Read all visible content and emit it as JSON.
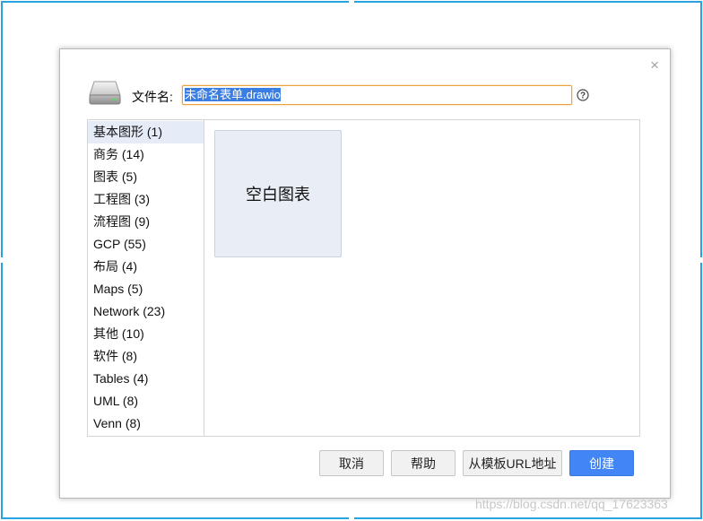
{
  "dialog": {
    "close_glyph": "×",
    "filename_label": "文件名:",
    "filename_value": "未命名表单.drawio",
    "help_glyph": "?",
    "categories": [
      {
        "label": "基本图形 (1)",
        "selected": true
      },
      {
        "label": "商务 (14)"
      },
      {
        "label": "图表 (5)"
      },
      {
        "label": "工程图 (3)"
      },
      {
        "label": "流程图 (9)"
      },
      {
        "label": "GCP (55)"
      },
      {
        "label": "布局 (4)"
      },
      {
        "label": "Maps (5)"
      },
      {
        "label": "Network (23)"
      },
      {
        "label": "其他 (10)"
      },
      {
        "label": "软件 (8)"
      },
      {
        "label": "Tables (4)"
      },
      {
        "label": "UML (8)"
      },
      {
        "label": "Venn (8)"
      }
    ],
    "templates": [
      {
        "label": "空白图表"
      }
    ],
    "buttons": {
      "cancel": "取消",
      "help": "帮助",
      "from_template_url": "从模板URL地址",
      "create": "创建"
    }
  },
  "icons": {
    "disk": "disk-icon",
    "help": "help-circle-icon",
    "close": "close-icon"
  },
  "colors": {
    "selection_frame": "#29a3e0",
    "primary_button": "#4285f4",
    "input_focus_border": "#e8a33b",
    "text_selection": "#3b7ee3",
    "selected_category": "#e6ecf7",
    "template_tile": "#e8edf6"
  },
  "watermark": "https://blog.csdn.net/qq_17623363"
}
